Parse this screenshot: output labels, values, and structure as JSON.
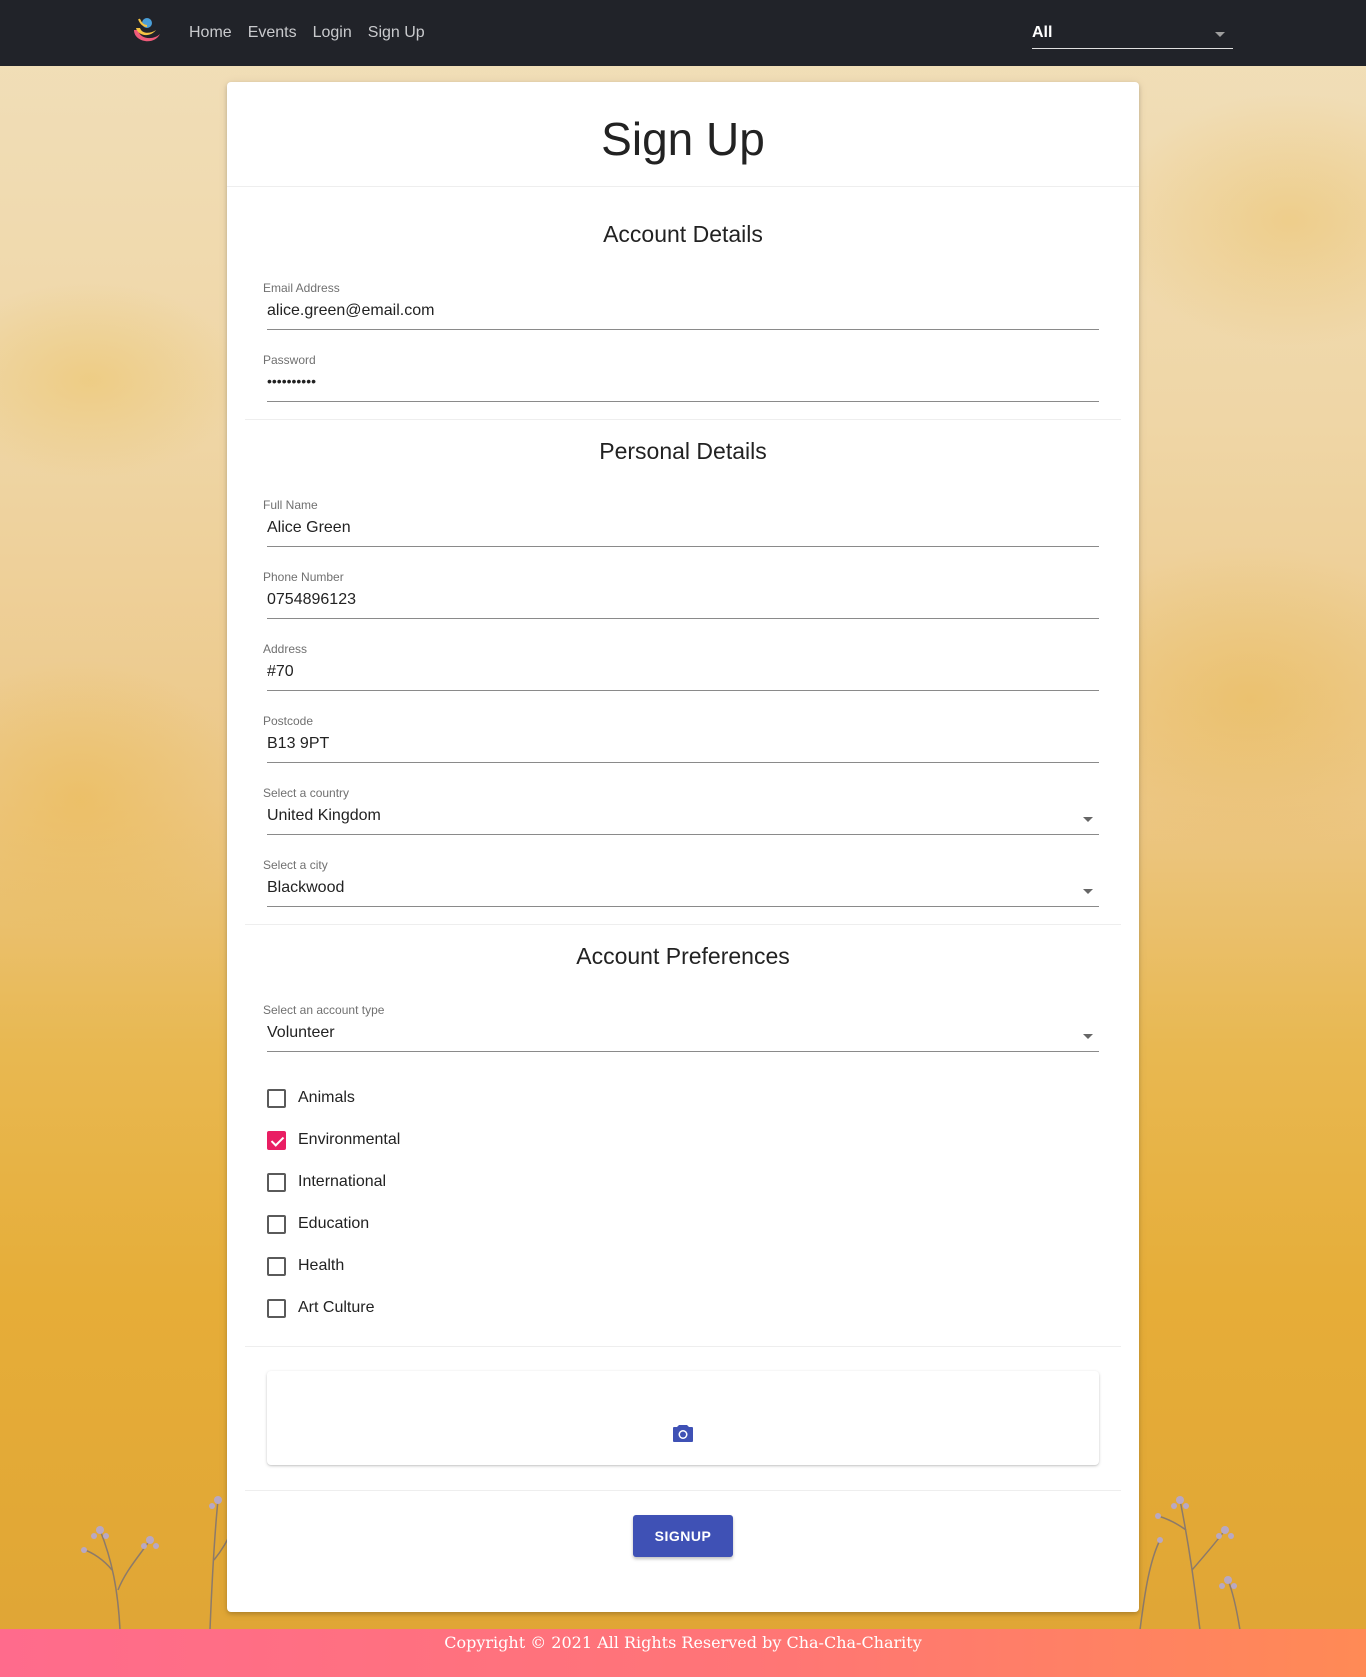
{
  "nav": {
    "links": [
      "Home",
      "Events",
      "Login",
      "Sign Up"
    ],
    "filter_value": "All"
  },
  "form": {
    "title": "Sign Up",
    "sections": {
      "account": "Account Details",
      "personal": "Personal Details",
      "preferences": "Account Preferences"
    },
    "email": {
      "label": "Email Address",
      "value": "alice.green@email.com"
    },
    "password": {
      "label": "Password",
      "value": "••••••••••"
    },
    "full_name": {
      "label": "Full Name",
      "value": "Alice Green"
    },
    "phone": {
      "label": "Phone Number",
      "value": "0754896123"
    },
    "address": {
      "label": "Address",
      "value": "#70"
    },
    "postcode": {
      "label": "Postcode",
      "value": "B13 9PT"
    },
    "country": {
      "label": "Select a country",
      "value": "United Kingdom"
    },
    "city": {
      "label": "Select a city",
      "value": "Blackwood"
    },
    "account_type": {
      "label": "Select an account type",
      "value": "Volunteer"
    },
    "interests": [
      {
        "label": "Animals",
        "checked": false
      },
      {
        "label": "Environmental",
        "checked": true
      },
      {
        "label": "International",
        "checked": false
      },
      {
        "label": "Education",
        "checked": false
      },
      {
        "label": "Health",
        "checked": false
      },
      {
        "label": "Art Culture",
        "checked": false
      }
    ],
    "upload_icon": "camera-icon",
    "submit_label": "SIGNUP"
  },
  "footer": {
    "text": "Copyright © 2021 All Rights Reserved by Cha-Cha-Charity"
  },
  "colors": {
    "navbar": "#212329",
    "primary": "#3f51b5",
    "checkbox_checked": "#e91e63",
    "footer_start": "#ff6b8c",
    "footer_end": "#ff8a55"
  }
}
